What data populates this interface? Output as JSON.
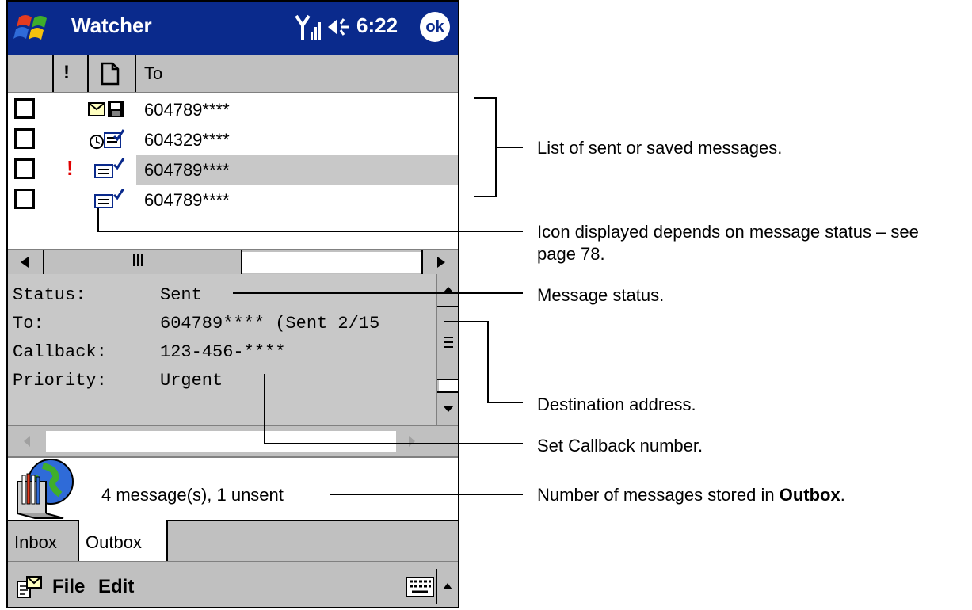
{
  "titlebar": {
    "title": "Watcher",
    "time": "6:22",
    "ok_label": "ok"
  },
  "columns": {
    "priority": "!",
    "to": "To"
  },
  "messages": [
    {
      "address": "604789****",
      "urgent": false,
      "icon": "saved-message-icon"
    },
    {
      "address": "604329****",
      "urgent": false,
      "icon": "pending-message-icon"
    },
    {
      "address": "604789****",
      "urgent": true,
      "urgent_mark": "!",
      "icon": "sent-message-icon",
      "selected": true
    },
    {
      "address": "604789****",
      "urgent": false,
      "icon": "sent-message-icon"
    }
  ],
  "detail": {
    "status_label": "Status:",
    "status_value": "Sent",
    "to_label": "To:",
    "to_value": "604789**** (Sent 2/15",
    "callback_label": "Callback:",
    "callback_value": "123-456-****",
    "priority_label": "Priority:",
    "priority_value": "Urgent"
  },
  "status_bar": {
    "text": "4 message(s), 1 unsent"
  },
  "tabs": [
    {
      "label": "Inbox"
    },
    {
      "label": "Outbox",
      "active": true
    }
  ],
  "menu": {
    "file": "File",
    "edit": "Edit"
  },
  "annotations": {
    "list": "List of sent or saved messages.",
    "icon_line1": "Icon displayed depends on message status – see",
    "icon_line2": "page 78.",
    "status": "Message status.",
    "destination": "Destination address.",
    "callback": "Set Callback number.",
    "count_prefix": "Number of messages stored in ",
    "count_bold": "Outbox",
    "count_suffix": "."
  },
  "colors": {
    "titlebar": "#0a2a8c",
    "urgent": "#e00000",
    "chrome": "#c0c0c0",
    "selection": "#c8c8c8"
  }
}
